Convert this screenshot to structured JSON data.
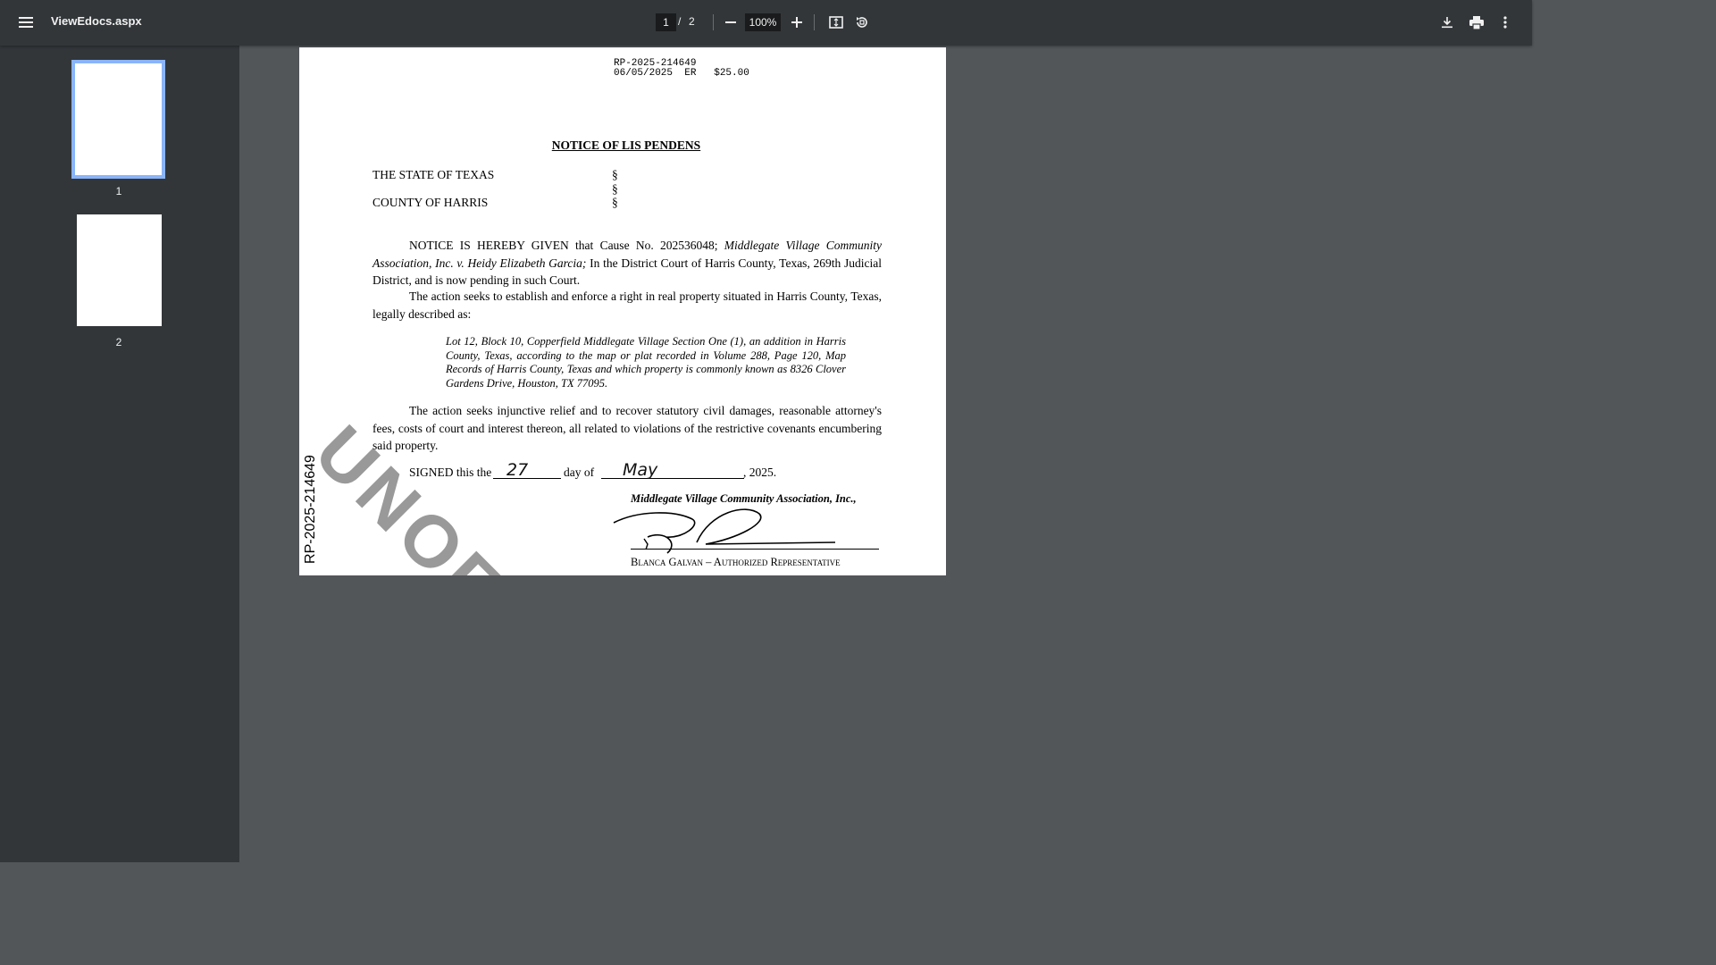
{
  "toolbar": {
    "title": "ViewEdocs.aspx",
    "current_page": "1",
    "page_separator": "/",
    "total_pages": "2",
    "zoom": "100%",
    "icons": [
      "menu-icon",
      "zoom-out-icon",
      "zoom-in-icon",
      "fit-page-icon",
      "rotate-icon",
      "download-icon",
      "print-icon",
      "more-options-icon"
    ]
  },
  "sidebar": {
    "thumbnails": [
      {
        "label": "1",
        "selected": true
      },
      {
        "label": "2",
        "selected": false
      }
    ]
  },
  "document": {
    "record_id": "RP-2025-214649",
    "filing_line": "06/05/2025  ER   $25.00",
    "title": "NOTICE OF LIS PENDENS",
    "state": "THE STATE OF TEXAS",
    "county": "COUNTY OF HARRIS",
    "section_mark": "§",
    "para1_start": "NOTICE IS HEREBY GIVEN that Cause No. 202536048; ",
    "para1_case": "Middlegate Village Community Association, Inc. v. Heidy Elizabeth Garcia;",
    "para1_end": " In the District Court of Harris County, Texas, 269th Judicial District, and is now pending in such Court.",
    "para2": "The action seeks to establish and enforce a right in real property situated in Harris County, Texas, legally described as:",
    "legal_description": "Lot 12, Block 10, Copperfield Middlegate Village Section One (1), an addition in Harris County, Texas, according to the map or plat recorded in Volume 288, Page 120, Map Records of Harris County, Texas and which property is commonly known as 8326 Clover Gardens Drive, Houston, TX 77095.",
    "para3": "The action seeks injunctive relief and to recover statutory civil damages, reasonable attorney's fees, costs of court and interest thereon, all related to violations of the restrictive covenants encumbering said property.",
    "signed_prefix": "SIGNED this the",
    "signed_day": "27",
    "signed_middle": "day of",
    "signed_month": "May",
    "signed_year": ", 2025.",
    "association": "Middlegate Village Community Association, Inc.,",
    "signer": "Blanca Galvan – Authorized Representative",
    "side_id": "RP-2025-214649",
    "watermark": "UNOFFICIAL"
  }
}
